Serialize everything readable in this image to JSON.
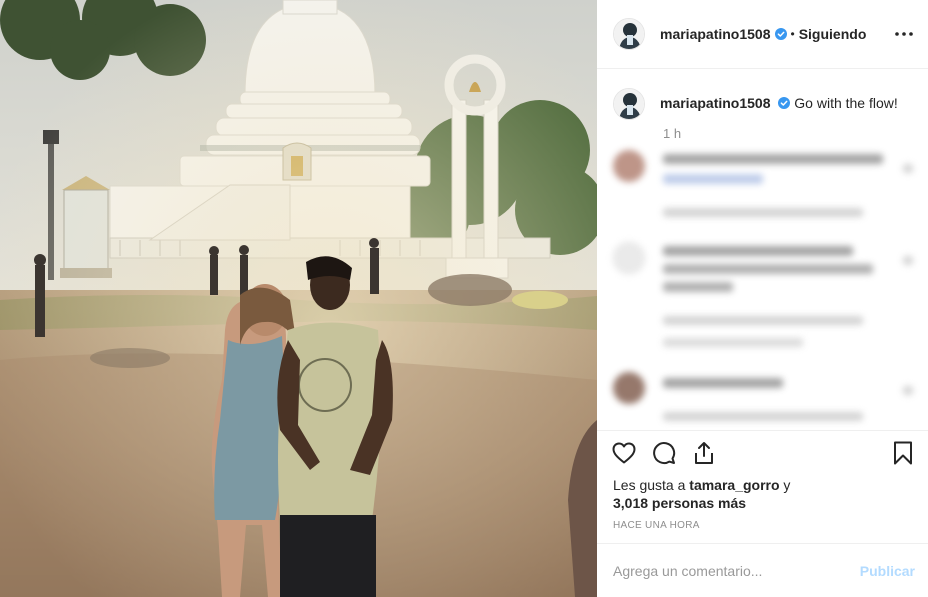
{
  "post": {
    "username": "mariapatino1508",
    "follow_separator": "•",
    "follow_status": "Siguiendo",
    "caption_text": "Go with the flow!",
    "caption_time": "1 h",
    "likes_prefix": "Les gusta a ",
    "likes_user": "tamara_gorro",
    "likes_suffix": " y",
    "likes_others": "3,018 personas más",
    "posted_ago": "HACE UNA HORA",
    "comment_placeholder": "Agrega un comentario...",
    "publish_label": "Publicar"
  },
  "icons": {
    "verified": "verified-badge-icon",
    "more": "more-options-icon",
    "like": "heart-icon",
    "comment": "comment-icon",
    "share": "share-icon",
    "save": "bookmark-icon"
  },
  "colors": {
    "verified_blue": "#3897f0",
    "publish_disabled": "#b3dbff",
    "secondary_text": "#8e8e8e"
  }
}
